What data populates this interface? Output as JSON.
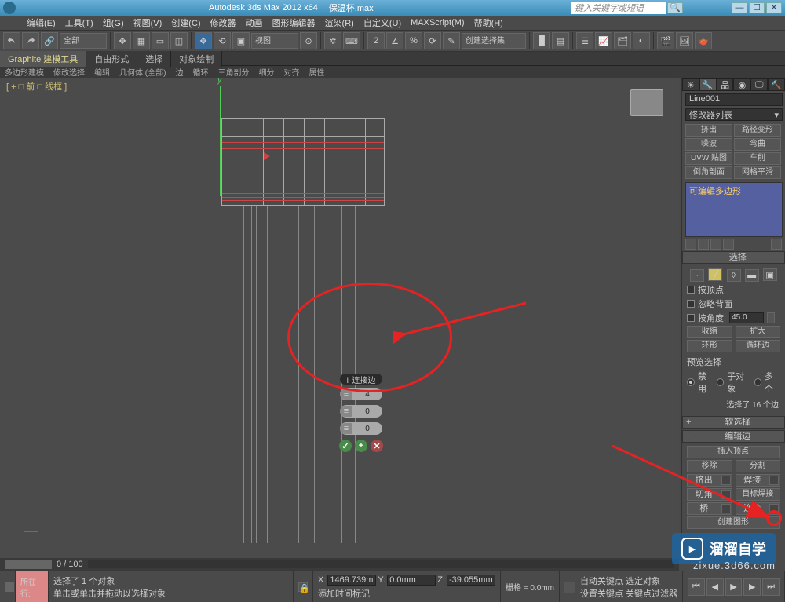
{
  "title": {
    "app": "Autodesk 3ds Max  2012  x64",
    "doc": "保温杯.max"
  },
  "searchPlaceholder": "键入关键字或短语",
  "menu": [
    "编辑(E)",
    "工具(T)",
    "组(G)",
    "视图(V)",
    "创建(C)",
    "修改器",
    "动画",
    "图形编辑器",
    "渲染(R)",
    "自定义(U)",
    "MAXScript(M)",
    "帮助(H)"
  ],
  "toolbar": {
    "dropAll": "全部",
    "dropView": "视图",
    "dropSel": "创建选择集"
  },
  "ribbon": {
    "tabs": [
      "Graphite 建模工具",
      "自由形式",
      "选择",
      "对象绘制"
    ],
    "row2": [
      "多边形建模",
      "修改选择",
      "编辑",
      "几何体 (全部)",
      "边",
      "循环",
      "三角剖分",
      "细分",
      "对齐",
      "属性"
    ]
  },
  "viewport": {
    "label": "[ + □ 前 □ 线框 ]"
  },
  "caddy": {
    "title": "‖ 连接边",
    "v1": "4",
    "v2": "0",
    "v3": "0"
  },
  "panel": {
    "objName": "Line001",
    "modList": "修改器列表",
    "mods": [
      "挤出",
      "路径变形",
      "噪波",
      "弯曲",
      "UVW 贴图",
      "车削",
      "倒角剖面",
      "网格平滑"
    ],
    "stackItem": "可编辑多边形",
    "rollSelect": "选择",
    "byVertex": "按顶点",
    "ignoreBack": "忽略背面",
    "byAngle": "按角度:",
    "angle": "45.0",
    "shrink": "收缩",
    "grow": "扩大",
    "ring": "环形",
    "loop": "循环边",
    "preview": "预览选择",
    "pvDisable": "禁用",
    "pvSub": "子对象",
    "pvMulti": "多个",
    "selInfo": "选择了 16 个边",
    "rollSoft": "软选择",
    "rollEdit": "编辑边",
    "insertV": "插入顶点",
    "remove": "移除",
    "split": "分割",
    "extrude": "挤出",
    "weld": "焊接",
    "chamfer": "切角",
    "targetWeld": "目标焊接",
    "bridge": "桥",
    "connect": "连接",
    "createShape": "创建图形"
  },
  "status": {
    "frame": "0 / 100",
    "selObj": "选择了 1 个对象",
    "hint": "单击或单击并拖动以选择对象",
    "x": "1469.739m",
    "y": "0.0mm",
    "z": "-39.055mm",
    "grid": "栅格 = 0.0mm",
    "autoKey": "自动关键点",
    "selLock": "选定对象",
    "setKey": "设置关键点",
    "keyFilter": "关键点过滤器",
    "addTag": "添加时间标记",
    "here": "所在行:"
  },
  "watermark": {
    "text": "溜溜自学",
    "url": "zixue.3d66.com"
  }
}
